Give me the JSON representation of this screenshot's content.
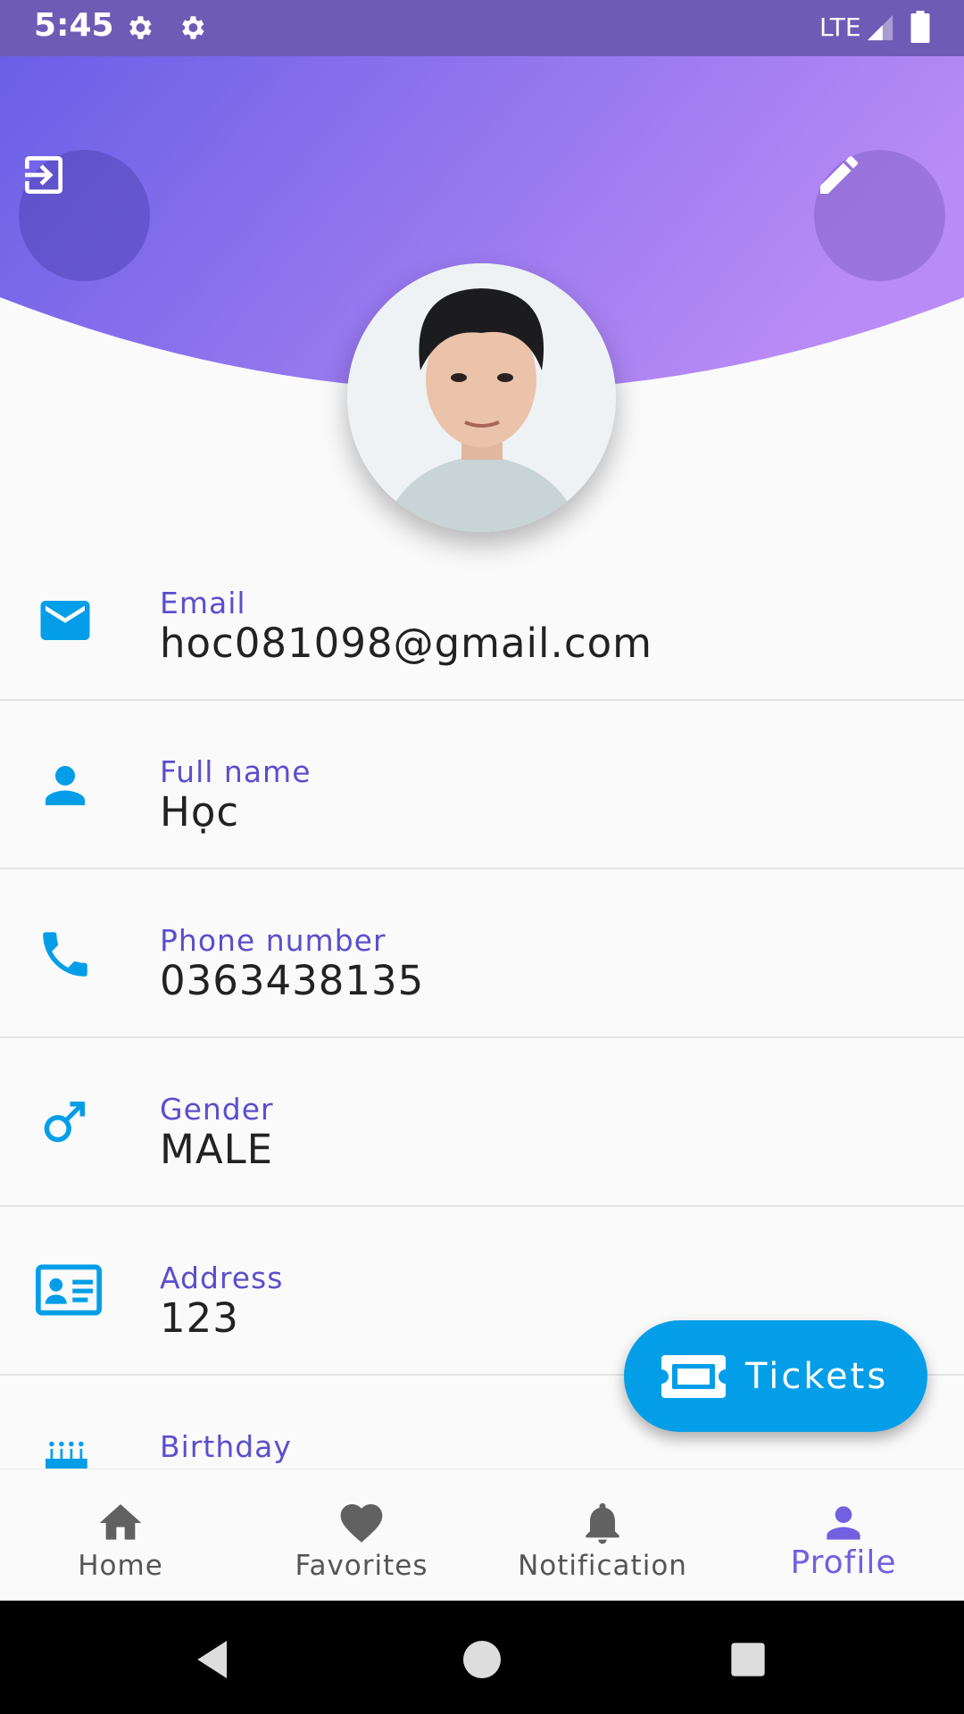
{
  "status_bar": {
    "time": "5:45",
    "network": "LTE"
  },
  "header": {
    "logout_icon": "logout-icon",
    "edit_icon": "edit-pencil-icon",
    "gradient": [
      "#6a5fe6",
      "#b98bf6"
    ]
  },
  "profile": {
    "fields": [
      {
        "label": "Email",
        "value": "hoc081098@gmail.com",
        "icon": "mail-icon"
      },
      {
        "label": "Full name",
        "value": "Học",
        "icon": "person-icon"
      },
      {
        "label": "Phone number",
        "value": "0363438135",
        "icon": "phone-icon"
      },
      {
        "label": "Gender",
        "value": "MALE",
        "icon": "male-icon"
      },
      {
        "label": "Address",
        "value": "123",
        "icon": "id-card-icon"
      },
      {
        "label": "Birthday",
        "value": "",
        "icon": "cake-icon"
      }
    ]
  },
  "fab": {
    "label": "Tickets",
    "icon": "ticket-icon"
  },
  "bottom_nav": {
    "items": [
      {
        "label": "Home",
        "icon": "home-icon"
      },
      {
        "label": "Favorites",
        "icon": "heart-icon"
      },
      {
        "label": "Notification",
        "icon": "bell-icon"
      },
      {
        "label": "Profile",
        "icon": "person-icon"
      }
    ],
    "active": "Profile"
  },
  "colors": {
    "accent": "#049ee8",
    "label": "#5b4fcc",
    "active_tab": "#7360e0",
    "status_bar": "#6e5bb5"
  }
}
